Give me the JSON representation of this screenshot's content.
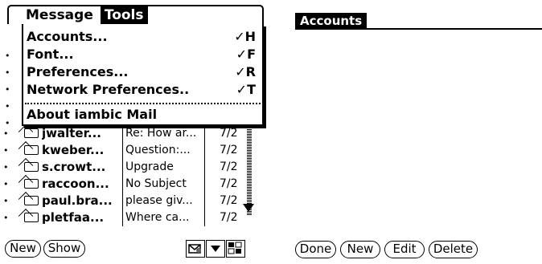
{
  "menubar": {
    "items": [
      "Message",
      "Tools"
    ]
  },
  "tools_menu": {
    "items": [
      {
        "label": "Accounts...",
        "shortcut": "✓H"
      },
      {
        "label": "Font...",
        "shortcut": "✓F"
      },
      {
        "label": "Preferences...",
        "shortcut": "✓R"
      },
      {
        "label": "Network Preferences..",
        "shortcut": "✓T"
      },
      {
        "label": "About iambic Mail"
      }
    ]
  },
  "messages": [
    {
      "sender": "jwalter...",
      "subject": "Re: How ar...",
      "date": "7/2"
    },
    {
      "sender": "kweber...",
      "subject": "Question:...",
      "date": "7/2"
    },
    {
      "sender": "s.crowt...",
      "subject": "Upgrade",
      "date": "7/2"
    },
    {
      "sender": "raccoon...",
      "subject": "No Subject",
      "date": "7/2"
    },
    {
      "sender": "paul.bra...",
      "subject": "please giv...",
      "date": "7/2"
    },
    {
      "sender": "pletfaa...",
      "subject": "Where ca...",
      "date": "7/2"
    }
  ],
  "left_buttons": {
    "new": "New",
    "show": "Show"
  },
  "accounts": {
    "title": "Accounts",
    "buttons": {
      "done": "Done",
      "new": "New",
      "edit": "Edit",
      "delete": "Delete"
    }
  }
}
